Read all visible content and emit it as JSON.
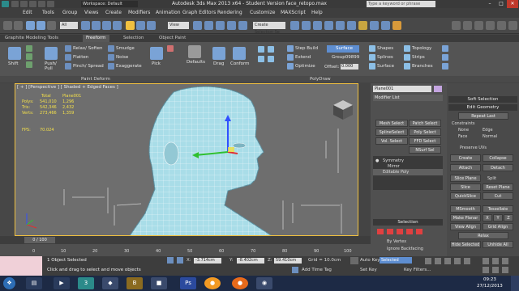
{
  "window": {
    "title": "Autodesk 3ds Max 2013 x64  -  Student Version   face_retopo.max",
    "workspace": "Workspace: Default",
    "search_placeholder": "Type a keyword or phrase"
  },
  "menu": [
    "Edit",
    "Tools",
    "Group",
    "Views",
    "Create",
    "Modifiers",
    "Animation",
    "Graph Editors",
    "Rendering",
    "Customize",
    "MAXScript",
    "Help"
  ],
  "toolbar": {
    "selection_filter": "All",
    "view": "View",
    "selection_set": "Create Selection Se"
  },
  "ribbon": {
    "tabs": [
      "Graphite Modeling Tools",
      "Freeform",
      "Selection",
      "Object Paint"
    ],
    "active_tab": "Freeform",
    "shift_label": "Shift",
    "pushpull_label": "Push/ Pull",
    "relax_label": "Relax/ Soften",
    "flatten_label": "Flatten",
    "pinch_label": "Pinch/ Spread",
    "smudge_label": "Smudge",
    "noise_label": "Noise",
    "exaggerate_label": "Exaggerate",
    "pick_label": "Pick",
    "defaults_label": "Defaults",
    "drag_label": "Drag",
    "conform_label": "Conform",
    "stepbuild_label": "Step Build",
    "extend_label": "Extend",
    "optimize_label": "Optimize",
    "surface_label": "Surface",
    "group_label": "Group09899",
    "offset_label": "Offset:",
    "offset_value": "0.000",
    "shapes_label": "Shapes",
    "splines_label": "Splines",
    "surface2_label": "Surface",
    "topology_label": "Topology",
    "strips_label": "Strips",
    "branches_label": "Branches",
    "paint_deform": "Paint Deform",
    "polydraw": "PolyDraw"
  },
  "viewport": {
    "label": "[ + ] [Perspective ] [ Shaded + Edged Faces ]",
    "stats_headers": [
      "Total",
      "Plane001"
    ],
    "stats": [
      {
        "name": "Polys:",
        "total": "541,010",
        "obj": "1,296"
      },
      {
        "name": "Tris:",
        "total": "542,346",
        "obj": "2,432"
      },
      {
        "name": "Verts:",
        "total": "273,466",
        "obj": "1,359"
      }
    ],
    "fps_label": "FPS:",
    "fps_value": "70.024"
  },
  "command_panel": {
    "object_name": "Plane001",
    "modifier_list": "Modifier List",
    "buttons": [
      "Mesh Select",
      "Patch Select",
      "SplineSelect",
      "Poly Select",
      "Vol. Select",
      "FFD Select",
      "",
      "NSurf Sel"
    ],
    "stack": [
      "Symmetry",
      "Mirror",
      "Editable Poly"
    ],
    "selection_head": "Selection",
    "by_vertex": "By Vertex",
    "ignore_backfacing": "Ignore Backfacing"
  },
  "right_panel": {
    "soft_selection": "Soft Selection",
    "edit_geometry": "Edit Geometry",
    "repeat_last": "Repeat Last",
    "constraints": "Constraints",
    "none": "None",
    "edge": "Edge",
    "face": "Face",
    "normal": "Normal",
    "preserve_uvs": "Preserve UVs",
    "create": "Create",
    "collapse": "Collapse",
    "attach": "Attach",
    "detach": "Detach",
    "slice_plane": "Slice Plane",
    "split": "Split",
    "slice": "Slice",
    "reset_plane": "Reset Plane",
    "quickslice": "QuickSlice",
    "cut": "Cut",
    "msmooth": "MSmooth",
    "tessellate": "Tessellate",
    "make_planar": "Make Planar",
    "x": "X",
    "y": "Y",
    "z": "Z",
    "view_align": "View Align",
    "grid_align": "Grid Align",
    "relax": "Relax",
    "hide_selected": "Hide Selected",
    "unhide_all": "Unhide All"
  },
  "timeline": {
    "frame": "0 / 100",
    "ticks": [
      "0",
      "10",
      "20",
      "30",
      "40",
      "50",
      "60",
      "70",
      "80",
      "90",
      "100"
    ]
  },
  "status": {
    "objects_selected": "1 Object Selected",
    "prompt": "Click and drag to select and move objects",
    "x_label": "X:",
    "x_value": "-3.714cm",
    "y_label": "Y:",
    "y_value": "-8.402cm",
    "z_label": "Z:",
    "z_value": "59.410cm",
    "grid": "Grid = 10.0cm",
    "add_time_tag": "Add Time Tag",
    "auto_key": "Auto Key",
    "set_key": "Set Key",
    "selected": "Selected",
    "key_filters": "Key Filters..."
  },
  "taskbar": {
    "time": "09:23",
    "date": "27/12/2013",
    "colors": {
      "chrome": "#e76a1b",
      "firefox": "#f29a23",
      "ps": "#2b4a9e",
      "max": "#2b8a8a"
    }
  }
}
